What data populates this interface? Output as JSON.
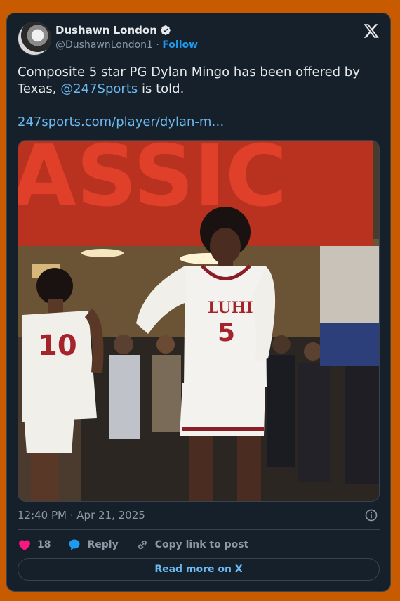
{
  "author": {
    "name": "Dushawn London",
    "handle": "@DushawnLondon1",
    "separator": "·",
    "follow_label": "Follow"
  },
  "tweet": {
    "text_before": "Composite 5 star PG Dylan Mingo has been offered by Texas, ",
    "mention": "@247Sports",
    "text_after": " is told.",
    "link": "247sports.com/player/dylan-m…"
  },
  "photo": {
    "banner_text": "ASSIC",
    "jersey_main_team": "LUHI",
    "jersey_main_number": "5",
    "jersey_back_number": "10"
  },
  "meta": {
    "timestamp": "12:40 PM · Apr 21, 2025"
  },
  "actions": {
    "like_count": "18",
    "reply_label": "Reply",
    "copy_label": "Copy link to post"
  },
  "read_more_label": "Read more on X",
  "colors": {
    "background": "#c85a00",
    "card": "#15202b",
    "accent": "#1d9bf0",
    "like": "#f91880"
  }
}
